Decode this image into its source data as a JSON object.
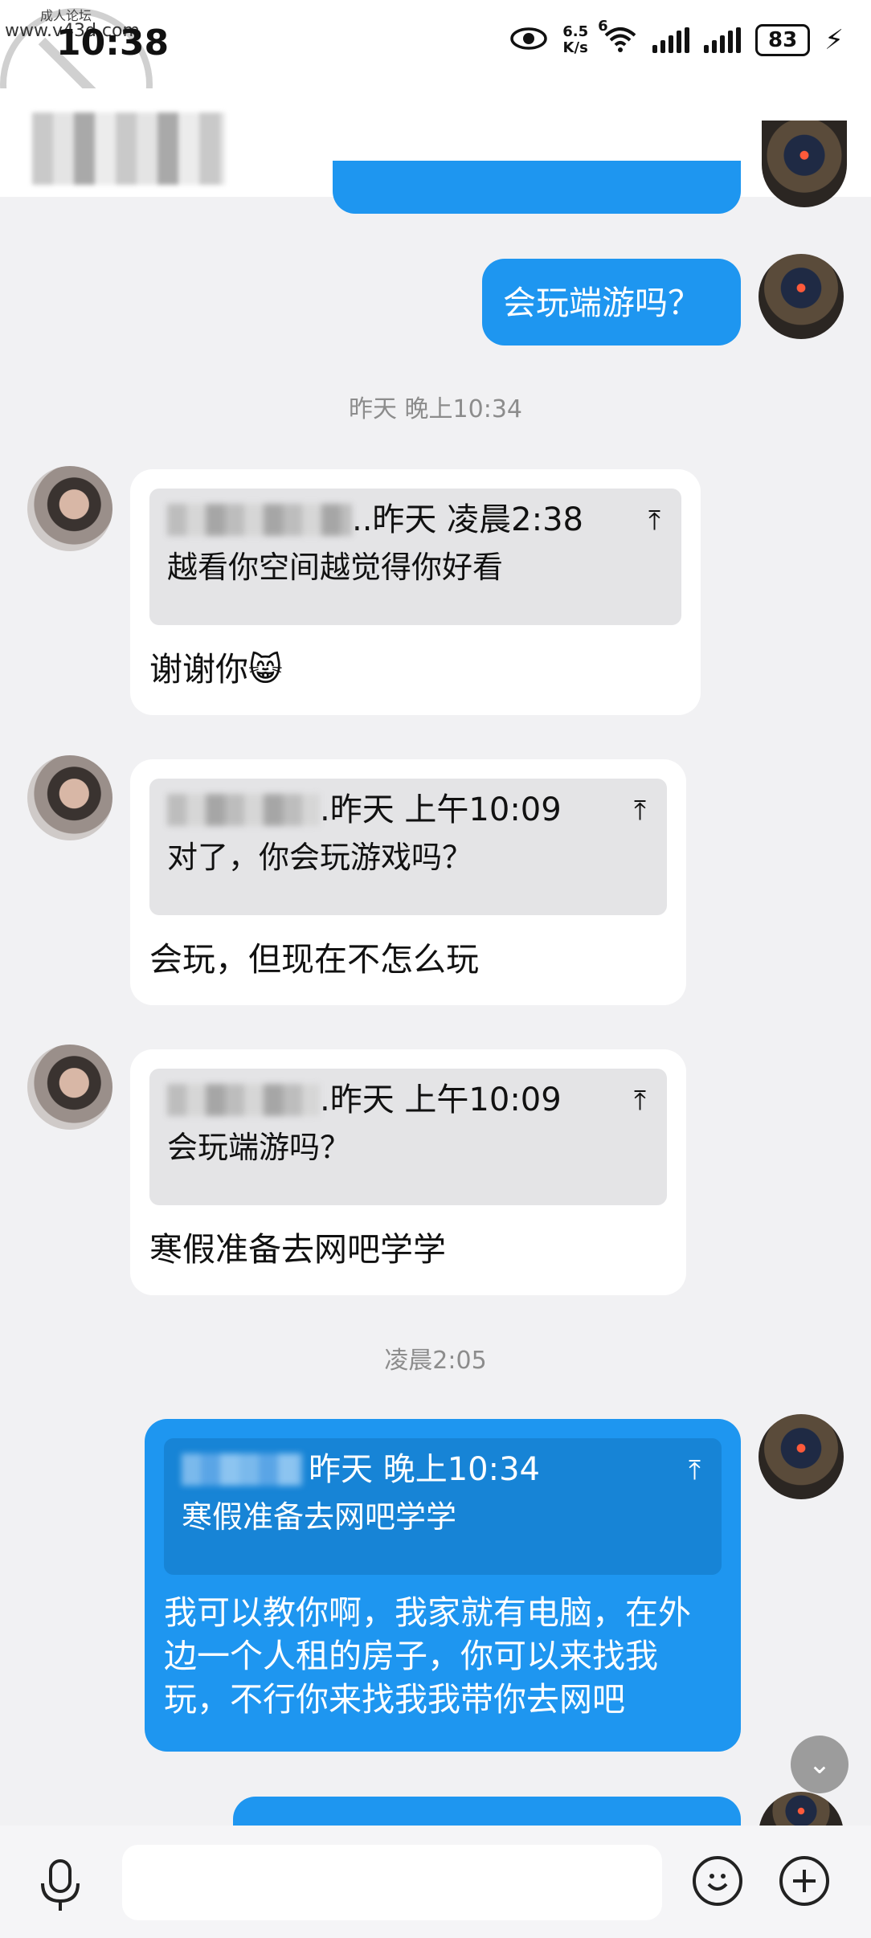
{
  "status": {
    "time": "10:38",
    "net_speed_value": "6.5",
    "net_speed_unit": "K/s",
    "network": "6",
    "battery": "83",
    "watermark_small": "成人论坛",
    "watermark_url": "www.v43d.com"
  },
  "header": {
    "menu_icon": "menu-icon"
  },
  "messages": [
    {
      "type": "outgoing",
      "text": "会玩端游吗？"
    },
    {
      "type": "time",
      "text": "昨天 晚上10:34"
    },
    {
      "type": "incoming",
      "quote_head": "..昨天 凌晨2:38",
      "quote_body": "越看你空间越觉得你好看",
      "text": "谢谢你😸"
    },
    {
      "type": "incoming",
      "quote_head": ".昨天 上午10:09",
      "quote_body": "对了，你会玩游戏吗？",
      "text": "会玩，但现在不怎么玩"
    },
    {
      "type": "incoming",
      "quote_head": ".昨天 上午10:09",
      "quote_body": "会玩端游吗？",
      "text": "寒假准备去网吧学学"
    },
    {
      "type": "time",
      "text": "凌晨2:05"
    },
    {
      "type": "outgoing",
      "quote_head": "昨天 晚上10:34",
      "quote_body": "寒假准备去网吧学学",
      "text": "我可以教你啊，我家就有电脑，在外边一个人租的房子，你可以来找我玩，不行你来找我我带你去网吧"
    }
  ],
  "input": {
    "placeholder": ""
  },
  "colors": {
    "outgoing_bubble": "#1e96f0",
    "incoming_bubble": "#ffffff",
    "background": "#f1f1f3"
  }
}
